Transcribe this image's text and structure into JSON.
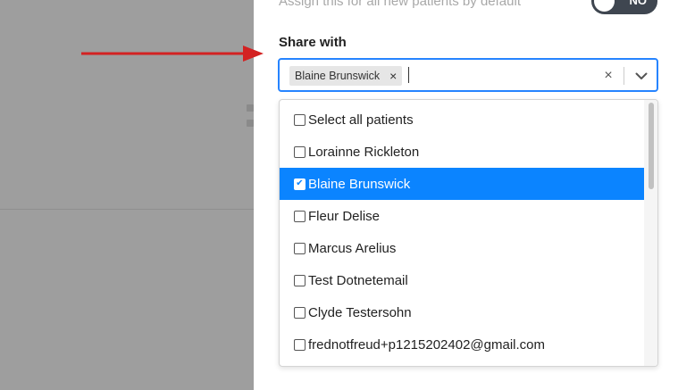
{
  "panel": {
    "assign_default_text": "Assign this for all new patients by default",
    "assign_toggle": {
      "state": "NO"
    }
  },
  "share": {
    "label": "Share with",
    "selected_chips": [
      {
        "label": "Blaine Brunswick",
        "remove_glyph": "×"
      }
    ],
    "clear_glyph": "×",
    "icons": {
      "clear": "close-icon",
      "dropdown": "chevron-down-icon",
      "chip_remove": "close-icon"
    }
  },
  "options": [
    {
      "label": "Select all patients",
      "checked": false
    },
    {
      "label": "Lorainne Rickleton",
      "checked": false
    },
    {
      "label": "Blaine Brunswick",
      "checked": true
    },
    {
      "label": "Fleur Delise",
      "checked": false
    },
    {
      "label": "Marcus Arelius",
      "checked": false
    },
    {
      "label": "Test Dotnetemail",
      "checked": false
    },
    {
      "label": "Clyde Testersohn",
      "checked": false
    },
    {
      "label": "frednotfreud+p1215202402@gmail.com",
      "checked": false
    }
  ],
  "colors": {
    "accent": "#0b84ff",
    "focus_border": "#2684ff",
    "annotation_arrow": "#d32222",
    "overlay": "#9e9e9e"
  }
}
